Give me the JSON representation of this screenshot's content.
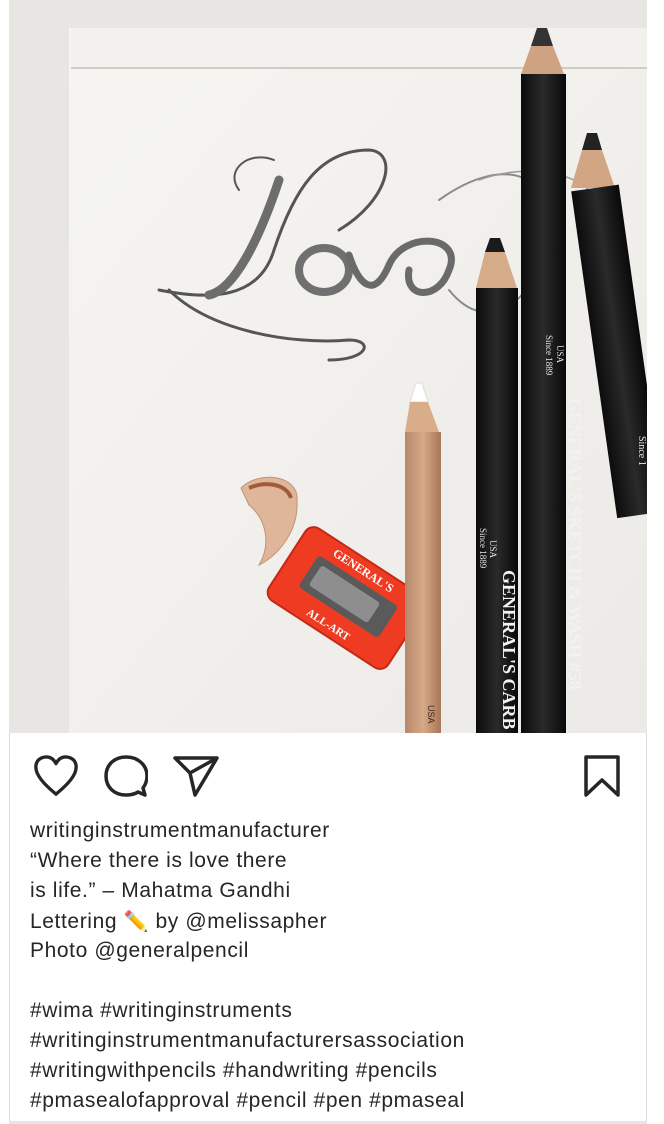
{
  "post": {
    "image_alt": "Love",
    "image_text": {
      "lettering": "Love",
      "sharpener_top": "GENERAL'S",
      "sharpener_bottom": "ALL-ART",
      "pencil1_usa": "USA",
      "pencil1_since": "Since 1889",
      "pencil1_brand": "GENERAL'S CARB",
      "pencil2_usa": "USA",
      "pencil2_since": "Since 1889",
      "pencil2_brand": "GENERAL'S SKETCH & WASH #58",
      "pencil3_since": "Since 1"
    },
    "actions": {
      "like_icon": "heart-icon",
      "comment_icon": "comment-icon",
      "share_icon": "paper-plane-icon",
      "save_icon": "bookmark-icon"
    },
    "caption": {
      "username": "writinginstrumentmanufacturer",
      "line1": "“Where there is love there",
      "line2": "is life.” – Mahatma Gandhi",
      "line3_before": "Lettering ",
      "line3_emoji": "✏️",
      "line3_after": " by @melissapher",
      "line4": "Photo @generalpencil",
      "hashtags1": "#wima #writinginstruments",
      "hashtags2": "#writinginstrumentmanufacturersassociation",
      "hashtags3": "#writingwithpencils #handwriting #pencils",
      "hashtags4": "#pmasealofapproval #pencil #pen #pmaseal"
    }
  }
}
